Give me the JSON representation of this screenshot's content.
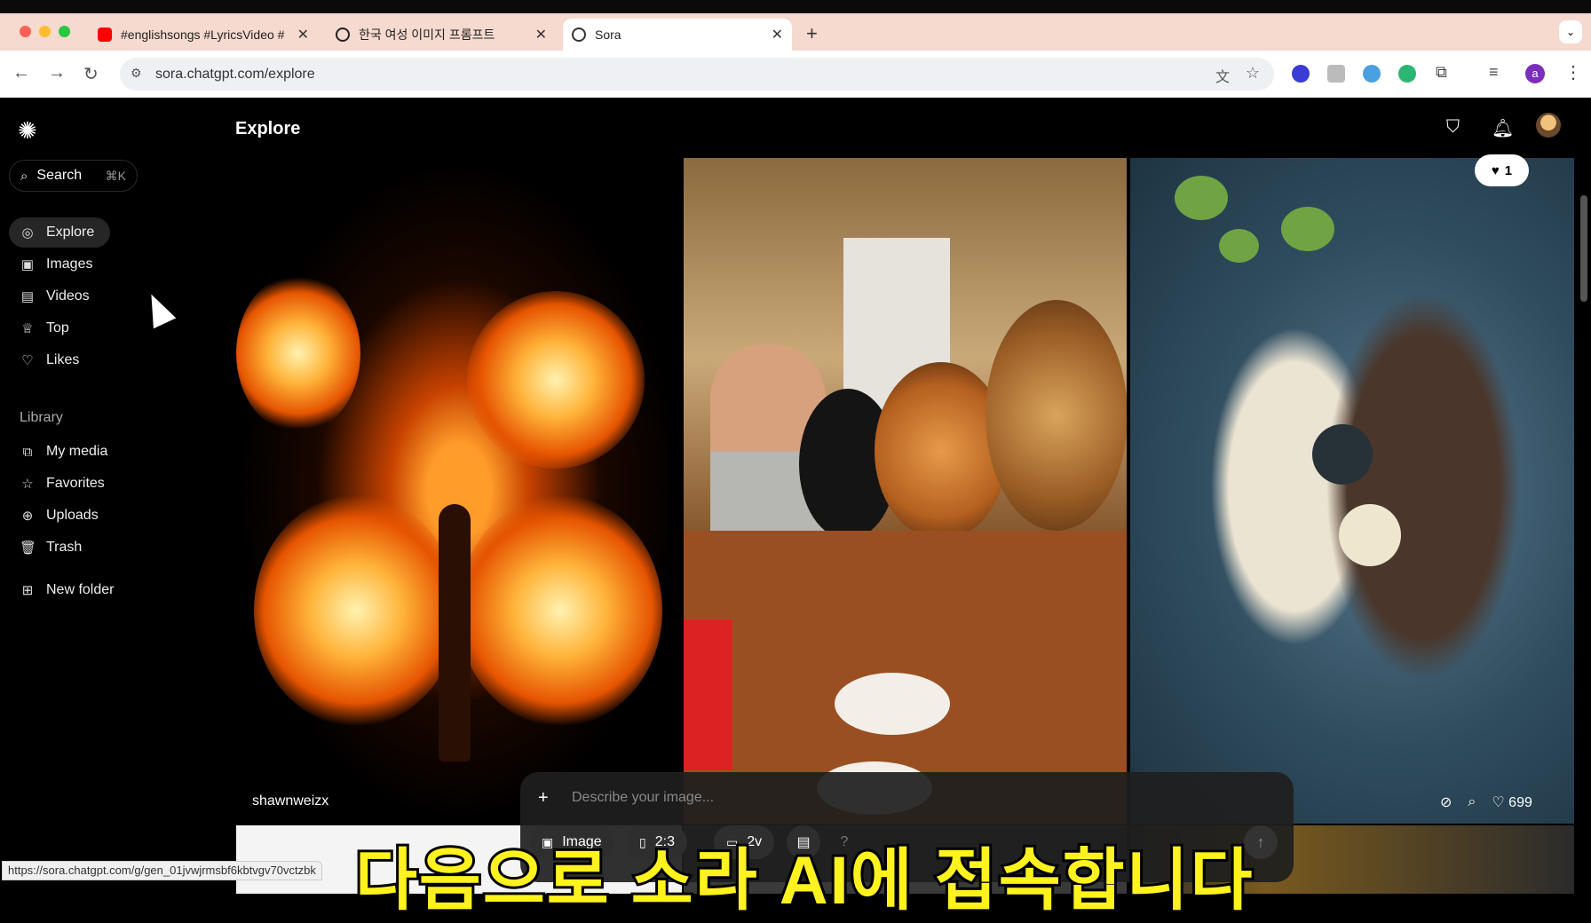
{
  "browser": {
    "tabs": [
      {
        "label": "#englishsongs #LyricsVideo #",
        "icon": "youtube-icon",
        "active": false
      },
      {
        "label": "한국 여성 이미지 프롬프트",
        "icon": "openai-icon",
        "active": false
      },
      {
        "label": "Sora",
        "icon": "sora-icon",
        "active": true
      }
    ],
    "new_tab": "+",
    "url": "sora.chatgpt.com/explore",
    "status_url": "https://sora.chatgpt.com/g/gen_01jvwjrmsbf6kbtvgv70vctzbk",
    "profile_initial": "a"
  },
  "sidebar": {
    "search_label": "Search",
    "search_shortcut": "⌘K",
    "nav": [
      {
        "label": "Explore",
        "icon": "compass-icon"
      },
      {
        "label": "Images",
        "icon": "image-icon"
      },
      {
        "label": "Videos",
        "icon": "video-icon"
      },
      {
        "label": "Top",
        "icon": "trophy-icon"
      },
      {
        "label": "Likes",
        "icon": "heart-icon"
      }
    ],
    "library_label": "Library",
    "library": [
      {
        "label": "My media",
        "icon": "media-icon"
      },
      {
        "label": "Favorites",
        "icon": "star-icon"
      },
      {
        "label": "Uploads",
        "icon": "upload-icon"
      },
      {
        "label": "Trash",
        "icon": "trash-icon"
      }
    ],
    "new_folder": "New folder"
  },
  "header": {
    "title": "Explore",
    "like_count": "1"
  },
  "gallery": {
    "first_credit": "shawnweizx",
    "third_likes": "699"
  },
  "subtitle": "다음으로 소라 AI에 접속합니다",
  "composer": {
    "plus": "+",
    "placeholder": "Describe your image...",
    "type_label": "Image",
    "ratio_label": "2:3",
    "variations_label": "2v",
    "help_label": "?"
  }
}
